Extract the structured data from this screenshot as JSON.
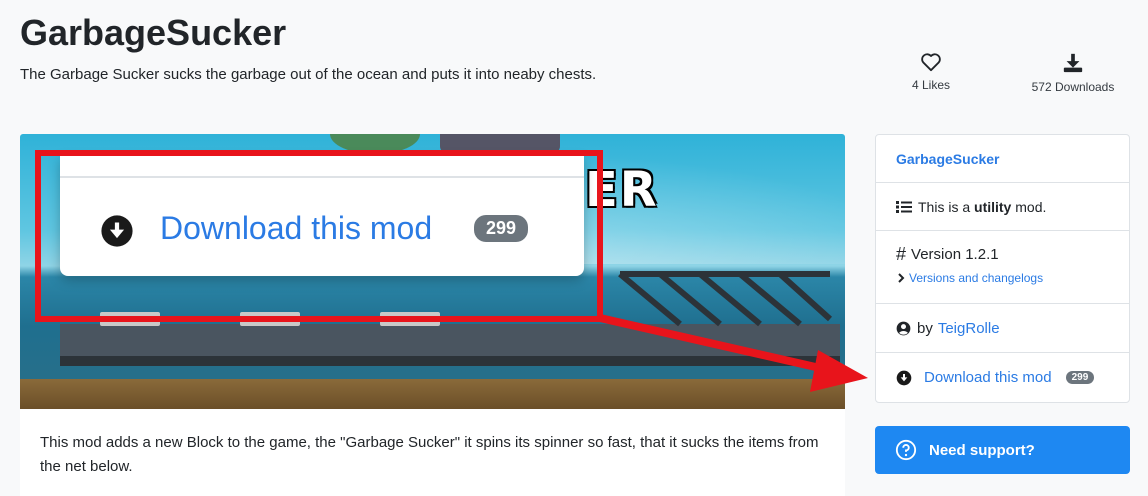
{
  "header": {
    "title": "GarbageSucker",
    "subtitle": "The Garbage Sucker sucks the garbage out of the ocean and puts it into neaby chests."
  },
  "stats": {
    "likes_label": "4 Likes",
    "downloads_label": "572 Downloads"
  },
  "banner": {
    "overlay_text": "ER",
    "zoom": {
      "download_label": "Download this mod",
      "badge": "299"
    }
  },
  "description": {
    "text": "This mod adds a new Block to the game, the \"Garbage Sucker\" it spins its spinner so fast, that it sucks the items from the net below."
  },
  "sidebar": {
    "mod_name": "GarbageSucker",
    "type_prefix": "This is a ",
    "type_value": "utility",
    "type_suffix": " mod.",
    "version": "Version 1.2.1",
    "versions_link": "Versions and changelogs",
    "author_prefix": "by",
    "author": "TeigRolle",
    "download_label": "Download this mod",
    "download_badge": "299"
  },
  "support": {
    "label": "Need support?"
  },
  "colors": {
    "link": "#2b7be4",
    "highlight": "#e8141b",
    "button": "#1e88f2",
    "badge": "#6c757d"
  },
  "icons": [
    "heart-icon",
    "download-tray-icon",
    "download-circle-icon",
    "list-icon",
    "hash-icon",
    "chevron-right-icon",
    "user-circle-icon",
    "question-circle-icon"
  ]
}
